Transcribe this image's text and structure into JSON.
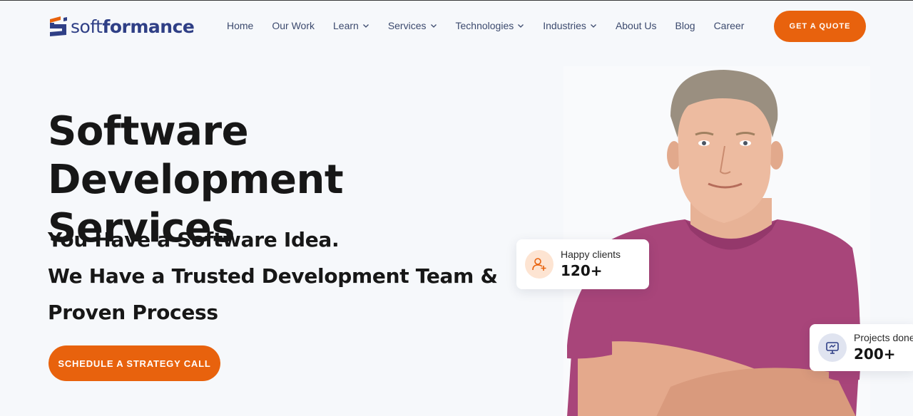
{
  "brand": {
    "name_light": "soft",
    "name_bold": "formance",
    "colors": {
      "primary": "#2f3f86",
      "accent": "#e8620d"
    }
  },
  "nav": {
    "items": [
      {
        "label": "Home",
        "has_dropdown": false
      },
      {
        "label": "Our Work",
        "has_dropdown": false
      },
      {
        "label": "Learn",
        "has_dropdown": true
      },
      {
        "label": "Services",
        "has_dropdown": true
      },
      {
        "label": "Technologies",
        "has_dropdown": true
      },
      {
        "label": "Industries",
        "has_dropdown": true
      },
      {
        "label": "About Us",
        "has_dropdown": false
      },
      {
        "label": "Blog",
        "has_dropdown": false
      },
      {
        "label": "Career",
        "has_dropdown": false
      }
    ],
    "quote_label": "GET A QUOTE"
  },
  "hero": {
    "title_line1": "Software Development",
    "title_line2": "Services",
    "sub_line1": "You Have a Software Idea.",
    "sub_line2": "We Have a Trusted Development Team &",
    "sub_line3": "Proven Process",
    "cta_label": "SCHEDULE A STRATEGY CALL"
  },
  "stats": {
    "clients": {
      "label": "Happy clients",
      "value": "120+",
      "icon": "add-user-icon"
    },
    "projects": {
      "label": "Projects done",
      "value": "200+",
      "icon": "monitor-chart-icon"
    }
  }
}
